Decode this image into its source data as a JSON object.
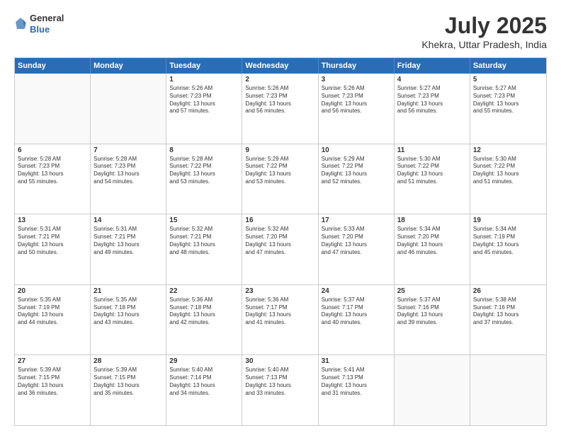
{
  "header": {
    "logo": {
      "line1": "General",
      "line2": "Blue"
    },
    "month_year": "July 2025",
    "location": "Khekra, Uttar Pradesh, India"
  },
  "days_of_week": [
    "Sunday",
    "Monday",
    "Tuesday",
    "Wednesday",
    "Thursday",
    "Friday",
    "Saturday"
  ],
  "weeks": [
    [
      {
        "day": "",
        "empty": true
      },
      {
        "day": "",
        "empty": true
      },
      {
        "day": "1",
        "line1": "Sunrise: 5:26 AM",
        "line2": "Sunset: 7:23 PM",
        "line3": "Daylight: 13 hours",
        "line4": "and 57 minutes."
      },
      {
        "day": "2",
        "line1": "Sunrise: 5:26 AM",
        "line2": "Sunset: 7:23 PM",
        "line3": "Daylight: 13 hours",
        "line4": "and 56 minutes."
      },
      {
        "day": "3",
        "line1": "Sunrise: 5:26 AM",
        "line2": "Sunset: 7:23 PM",
        "line3": "Daylight: 13 hours",
        "line4": "and 56 minutes."
      },
      {
        "day": "4",
        "line1": "Sunrise: 5:27 AM",
        "line2": "Sunset: 7:23 PM",
        "line3": "Daylight: 13 hours",
        "line4": "and 56 minutes."
      },
      {
        "day": "5",
        "line1": "Sunrise: 5:27 AM",
        "line2": "Sunset: 7:23 PM",
        "line3": "Daylight: 13 hours",
        "line4": "and 55 minutes."
      }
    ],
    [
      {
        "day": "6",
        "line1": "Sunrise: 5:28 AM",
        "line2": "Sunset: 7:23 PM",
        "line3": "Daylight: 13 hours",
        "line4": "and 55 minutes."
      },
      {
        "day": "7",
        "line1": "Sunrise: 5:28 AM",
        "line2": "Sunset: 7:23 PM",
        "line3": "Daylight: 13 hours",
        "line4": "and 54 minutes."
      },
      {
        "day": "8",
        "line1": "Sunrise: 5:28 AM",
        "line2": "Sunset: 7:22 PM",
        "line3": "Daylight: 13 hours",
        "line4": "and 53 minutes."
      },
      {
        "day": "9",
        "line1": "Sunrise: 5:29 AM",
        "line2": "Sunset: 7:22 PM",
        "line3": "Daylight: 13 hours",
        "line4": "and 53 minutes."
      },
      {
        "day": "10",
        "line1": "Sunrise: 5:29 AM",
        "line2": "Sunset: 7:22 PM",
        "line3": "Daylight: 13 hours",
        "line4": "and 52 minutes."
      },
      {
        "day": "11",
        "line1": "Sunrise: 5:30 AM",
        "line2": "Sunset: 7:22 PM",
        "line3": "Daylight: 13 hours",
        "line4": "and 51 minutes."
      },
      {
        "day": "12",
        "line1": "Sunrise: 5:30 AM",
        "line2": "Sunset: 7:22 PM",
        "line3": "Daylight: 13 hours",
        "line4": "and 51 minutes."
      }
    ],
    [
      {
        "day": "13",
        "line1": "Sunrise: 5:31 AM",
        "line2": "Sunset: 7:21 PM",
        "line3": "Daylight: 13 hours",
        "line4": "and 50 minutes."
      },
      {
        "day": "14",
        "line1": "Sunrise: 5:31 AM",
        "line2": "Sunset: 7:21 PM",
        "line3": "Daylight: 13 hours",
        "line4": "and 49 minutes."
      },
      {
        "day": "15",
        "line1": "Sunrise: 5:32 AM",
        "line2": "Sunset: 7:21 PM",
        "line3": "Daylight: 13 hours",
        "line4": "and 48 minutes."
      },
      {
        "day": "16",
        "line1": "Sunrise: 5:32 AM",
        "line2": "Sunset: 7:20 PM",
        "line3": "Daylight: 13 hours",
        "line4": "and 47 minutes."
      },
      {
        "day": "17",
        "line1": "Sunrise: 5:33 AM",
        "line2": "Sunset: 7:20 PM",
        "line3": "Daylight: 13 hours",
        "line4": "and 47 minutes."
      },
      {
        "day": "18",
        "line1": "Sunrise: 5:34 AM",
        "line2": "Sunset: 7:20 PM",
        "line3": "Daylight: 13 hours",
        "line4": "and 46 minutes."
      },
      {
        "day": "19",
        "line1": "Sunrise: 5:34 AM",
        "line2": "Sunset: 7:19 PM",
        "line3": "Daylight: 13 hours",
        "line4": "and 45 minutes."
      }
    ],
    [
      {
        "day": "20",
        "line1": "Sunrise: 5:35 AM",
        "line2": "Sunset: 7:19 PM",
        "line3": "Daylight: 13 hours",
        "line4": "and 44 minutes."
      },
      {
        "day": "21",
        "line1": "Sunrise: 5:35 AM",
        "line2": "Sunset: 7:18 PM",
        "line3": "Daylight: 13 hours",
        "line4": "and 43 minutes."
      },
      {
        "day": "22",
        "line1": "Sunrise: 5:36 AM",
        "line2": "Sunset: 7:18 PM",
        "line3": "Daylight: 13 hours",
        "line4": "and 42 minutes."
      },
      {
        "day": "23",
        "line1": "Sunrise: 5:36 AM",
        "line2": "Sunset: 7:17 PM",
        "line3": "Daylight: 13 hours",
        "line4": "and 41 minutes."
      },
      {
        "day": "24",
        "line1": "Sunrise: 5:37 AM",
        "line2": "Sunset: 7:17 PM",
        "line3": "Daylight: 13 hours",
        "line4": "and 40 minutes."
      },
      {
        "day": "25",
        "line1": "Sunrise: 5:37 AM",
        "line2": "Sunset: 7:16 PM",
        "line3": "Daylight: 13 hours",
        "line4": "and 39 minutes."
      },
      {
        "day": "26",
        "line1": "Sunrise: 5:38 AM",
        "line2": "Sunset: 7:16 PM",
        "line3": "Daylight: 13 hours",
        "line4": "and 37 minutes."
      }
    ],
    [
      {
        "day": "27",
        "line1": "Sunrise: 5:39 AM",
        "line2": "Sunset: 7:15 PM",
        "line3": "Daylight: 13 hours",
        "line4": "and 36 minutes."
      },
      {
        "day": "28",
        "line1": "Sunrise: 5:39 AM",
        "line2": "Sunset: 7:15 PM",
        "line3": "Daylight: 13 hours",
        "line4": "and 35 minutes."
      },
      {
        "day": "29",
        "line1": "Sunrise: 5:40 AM",
        "line2": "Sunset: 7:14 PM",
        "line3": "Daylight: 13 hours",
        "line4": "and 34 minutes."
      },
      {
        "day": "30",
        "line1": "Sunrise: 5:40 AM",
        "line2": "Sunset: 7:13 PM",
        "line3": "Daylight: 13 hours",
        "line4": "and 33 minutes."
      },
      {
        "day": "31",
        "line1": "Sunrise: 5:41 AM",
        "line2": "Sunset: 7:13 PM",
        "line3": "Daylight: 13 hours",
        "line4": "and 31 minutes."
      },
      {
        "day": "",
        "empty": true
      },
      {
        "day": "",
        "empty": true
      }
    ]
  ]
}
